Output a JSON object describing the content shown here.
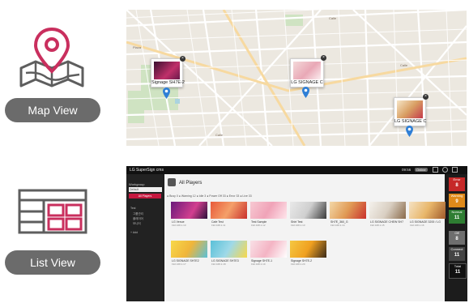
{
  "labels": {
    "map_view": "Map View",
    "list_view": "List View"
  },
  "colors": {
    "icon_pink": "#c92f5e",
    "icon_gray": "#5e5e5e",
    "pill_gray": "#6b6b6b",
    "lg_red": "#c6183f"
  },
  "map": {
    "cards": [
      {
        "label": "Signage SH7E-2"
      },
      {
        "label": "LG SIGNAGE C"
      },
      {
        "label": "LG SIGNAGE C"
      }
    ]
  },
  "app": {
    "title": "LG SuperSign cms",
    "header_time": "09:56",
    "header_btn": "Online",
    "page_title": "All Players",
    "sidebar": {
      "section": "Workgroup",
      "search": "Default",
      "button": "All Players",
      "items": [
        "Test",
        "그룹관리",
        "플레이어",
        "모니터",
        "+ Add"
      ]
    },
    "filter_text": "● Busy 0  ● Warning 12  ● Idle 3  ● Power Off 33  ● Error 33  ● Live 33",
    "tiles": [
      {
        "name": "LG Venue",
        "sub": "192.168.1.10"
      },
      {
        "name": "Cafe Test",
        "sub": "192.168.1.11"
      },
      {
        "name": "Test Sample",
        "sub": "192.168.1.12"
      },
      {
        "name": "Shirt Test",
        "sub": "192.168.1.13"
      },
      {
        "name": "SH7E_360_G",
        "sub": "192.168.1.14"
      },
      {
        "name": "LG SIGNAGE CHEW SH7",
        "sub": "192.168.1.15"
      },
      {
        "name": "LG SIGNAGE 3200 / LG",
        "sub": "192.168.1.16"
      },
      {
        "name": "LG SIGNAGE SH7E2",
        "sub": "192.168.1.17"
      },
      {
        "name": "LG SIGNAGE SH7E3",
        "sub": "192.168.1.18"
      },
      {
        "name": "Signage SH7E-1",
        "sub": "192.168.1.19"
      },
      {
        "name": "Signage SH7E-2",
        "sub": "192.168.1.20"
      }
    ],
    "status": [
      {
        "label": "Error",
        "count": "8",
        "color": "#c62828"
      },
      {
        "label": "Warning",
        "count": "9",
        "color": "#e08a1a"
      },
      {
        "label": "Normal",
        "count": "11",
        "color": "#2e7d32"
      },
      {
        "label": "Off",
        "count": "8",
        "color": "#6e6e6e"
      },
      {
        "label": "Connect",
        "count": "11",
        "color": "#444444"
      },
      {
        "label": "Total",
        "count": "11",
        "color": "#111111"
      }
    ]
  }
}
